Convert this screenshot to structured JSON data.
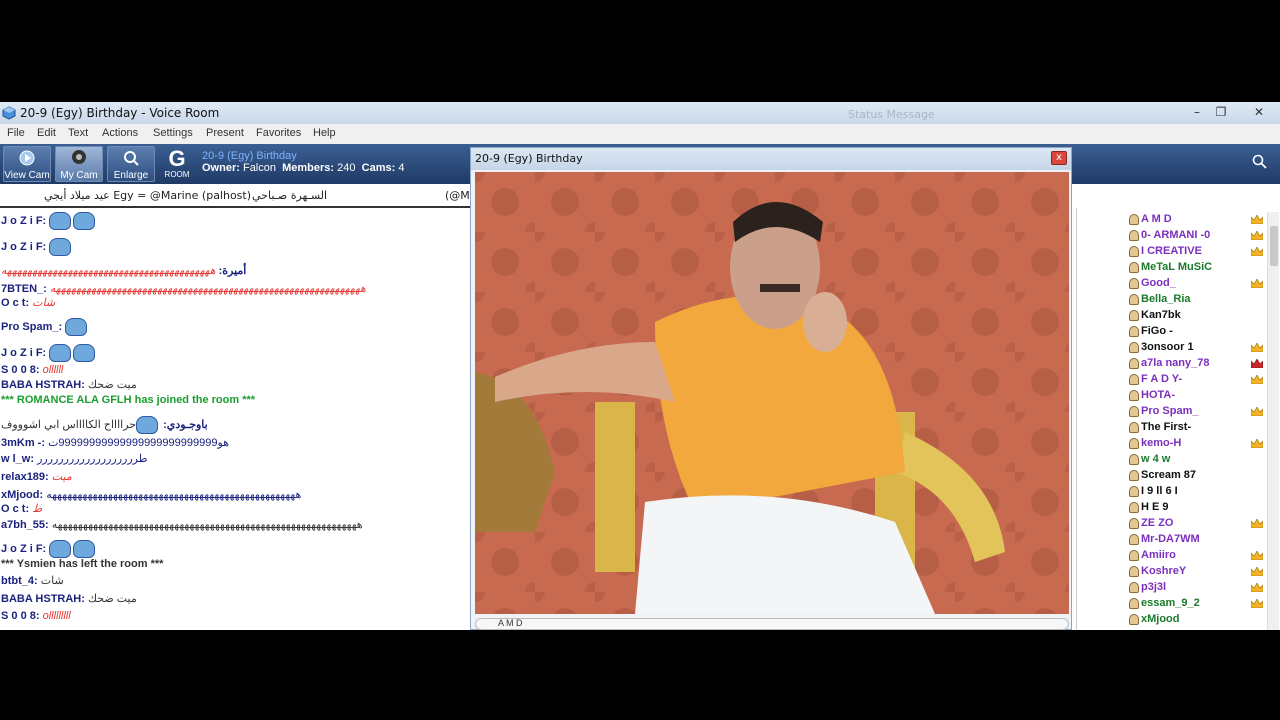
{
  "window": {
    "title": "20-9 (Egy) Birthday - Voice Room",
    "ghost_text": "Status Message"
  },
  "menu": [
    "File",
    "Edit",
    "Text",
    "Actions",
    "Settings",
    "Present",
    "Favorites",
    "Help"
  ],
  "toolbar": {
    "view_cam": "View Cam",
    "my_cam": "My Cam",
    "enlarge": "Enlarge",
    "room_letter": "G",
    "room_label": "ROOM",
    "room_name": "20-9 (Egy) Birthday",
    "owner_label": "Owner:",
    "owner_value": "Falcon",
    "members_label": "Members:",
    "members_value": "240",
    "cams_label": "Cams:",
    "cams_value": "4"
  },
  "topic": {
    "part1": "عيد ميلاد أيجي Egy = @Marine (palhost)",
    "part2": "السـهرة صـباحي",
    "part3": "(@M"
  },
  "chat": [
    {
      "nick": "J o Z i F:",
      "text": "",
      "emo": 2,
      "style": "blue"
    },
    {
      "nick": "J o Z i F:",
      "text": "",
      "emo": 1,
      "style": "blue"
    },
    {
      "nick": "أميرة:",
      "text": "هههههههههههههههههههههههههههههههههههههههههه",
      "emo": 0,
      "style": "red",
      "rtl": true
    },
    {
      "nick": "7BTEN_:",
      "text": "هههههههههههههههههههههههههههههههههههههههههههههههههههههههههههههه",
      "emo": 0,
      "style": "red"
    },
    {
      "nick": "O c t:",
      "text": "شات",
      "emo": 0,
      "style": "red"
    },
    {
      "nick": "Pro Spam_:",
      "text": "",
      "emo": 1,
      "style": "blue"
    },
    {
      "nick": "J o Z i F:",
      "text": "",
      "emo": 2,
      "style": "blue"
    },
    {
      "nick": "S 0 0 8:",
      "text": "ollllll",
      "emo": 0,
      "style": "red"
    },
    {
      "nick": "BABA HSTRAH:",
      "text": "ميت ضحك",
      "emo": 0,
      "style": "gray"
    },
    {
      "nick": "",
      "text": "*** ROMANCE ALA GFLH has joined the room ***",
      "emo": 0,
      "style": "sys"
    },
    {
      "nick": "باوجـودي:",
      "text": "حرااااح   الكااااس   ابي اشوووف",
      "emo": 1,
      "style": "gray"
    },
    {
      "nick": "3mKm -:",
      "text": "هو99999999999999999999999999ت",
      "emo": 0,
      "style": "blue"
    },
    {
      "nick": "w l_w:",
      "text": "طررررررررررررررررررر",
      "emo": 0,
      "style": "blue"
    },
    {
      "nick": "relax189:",
      "text": "ميت",
      "emo": 0,
      "style": "red"
    },
    {
      "nick": "xMjood:",
      "text": "هههههههههههههههههههههههههههههههههههههههههههههههههه",
      "emo": 0,
      "style": "blue"
    },
    {
      "nick": "O c t:",
      "text": "ط",
      "emo": 0,
      "style": "red"
    },
    {
      "nick": "a7bh_55:",
      "text": "ههههههههههههههههههههههههههههههههههههههههههههههههههههههههههههه",
      "emo": 0,
      "style": "gray"
    },
    {
      "nick": "J o Z i F:",
      "text": "",
      "emo": 2,
      "style": "blue"
    },
    {
      "nick": "",
      "text": "*** Ysmien has left the room ***",
      "emo": 0,
      "style": "sys2"
    },
    {
      "nick": "btbt_4:",
      "text": "شات",
      "emo": 0,
      "style": "gray"
    },
    {
      "nick": "BABA HSTRAH:",
      "text": "ميت ضحك",
      "emo": 0,
      "style": "gray"
    },
    {
      "nick": "S 0 0 8:",
      "text": "olllllllll",
      "emo": 0,
      "style": "red"
    }
  ],
  "cam": {
    "title": "20-9 (Egy) Birthday",
    "close": "x",
    "footer_name": "A M D"
  },
  "users": [
    {
      "name": "A M D",
      "color": "#7b2fbe",
      "crown": "gold"
    },
    {
      "name": "0- ARMANI -0",
      "color": "#7b2fbe",
      "crown": "gold"
    },
    {
      "name": "I CREATIVE",
      "color": "#7b2fbe",
      "crown": "gold"
    },
    {
      "name": "MeTaL MuSiC",
      "color": "#1b7a2b",
      "crown": ""
    },
    {
      "name": "Good_",
      "color": "#7b2fbe",
      "crown": "gold"
    },
    {
      "name": "Bella_Ria",
      "color": "#1b7a2b",
      "crown": ""
    },
    {
      "name": "Kan7bk",
      "color": "#111111",
      "crown": ""
    },
    {
      "name": "FiGo -",
      "color": "#111111",
      "crown": ""
    },
    {
      "name": "3onsoor 1",
      "color": "#111111",
      "crown": "gold"
    },
    {
      "name": "a7la nany_78",
      "color": "#7b2fbe",
      "crown": "red"
    },
    {
      "name": "F A D Y-",
      "color": "#7b2fbe",
      "crown": "gold"
    },
    {
      "name": "HOTA-",
      "color": "#7b2fbe",
      "crown": ""
    },
    {
      "name": "Pro Spam_",
      "color": "#7b2fbe",
      "crown": "gold"
    },
    {
      "name": "The First-",
      "color": "#111111",
      "crown": ""
    },
    {
      "name": "kemo-H",
      "color": "#7b2fbe",
      "crown": "gold"
    },
    {
      "name": "w 4 w",
      "color": "#1b7a2b",
      "crown": ""
    },
    {
      "name": "Scream 87",
      "color": "#111111",
      "crown": ""
    },
    {
      "name": "I 9 ll 6 I",
      "color": "#111111",
      "crown": ""
    },
    {
      "name": "H E 9",
      "color": "#111111",
      "crown": ""
    },
    {
      "name": "ZE ZO",
      "color": "#7b2fbe",
      "crown": "gold"
    },
    {
      "name": "Mr-DA7WM",
      "color": "#7b2fbe",
      "crown": ""
    },
    {
      "name": "Amiiro",
      "color": "#7b2fbe",
      "crown": "gold"
    },
    {
      "name": "KoshreY",
      "color": "#7b2fbe",
      "crown": "gold"
    },
    {
      "name": "p3j3l",
      "color": "#7b2fbe",
      "crown": "gold"
    },
    {
      "name": "essam_9_2",
      "color": "#1b7a2b",
      "crown": "gold"
    },
    {
      "name": "xMjood",
      "color": "#1b7a2b",
      "crown": ""
    }
  ]
}
